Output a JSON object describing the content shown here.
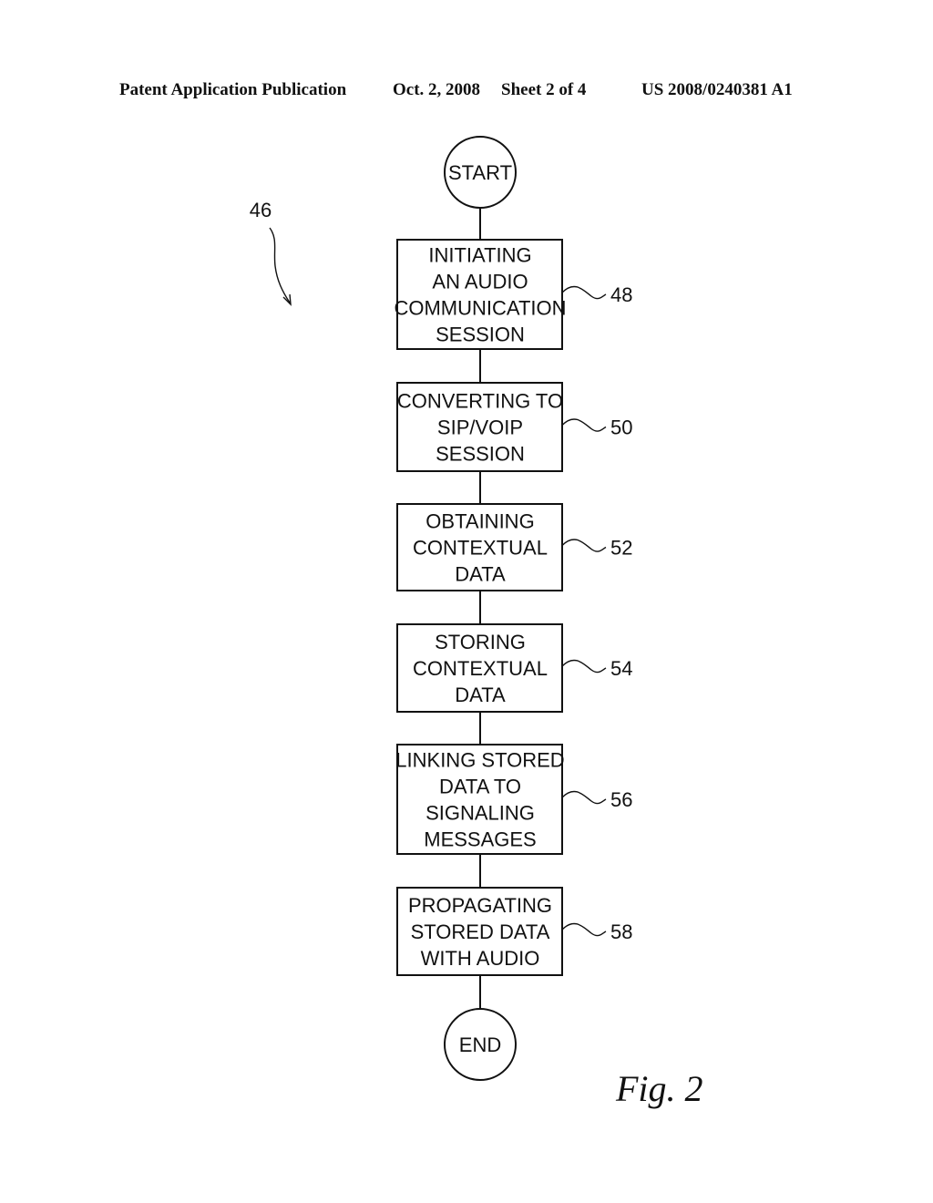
{
  "header": {
    "publication_type": "Patent Application Publication",
    "date": "Oct. 2, 2008",
    "sheet": "Sheet 2 of 4",
    "publication_number": "US 2008/0240381 A1"
  },
  "figure": {
    "label": "Fig. 2",
    "reference_number": "46",
    "start_label": "START",
    "end_label": "END",
    "steps": [
      {
        "ref": "48",
        "lines": [
          "INITIATING",
          "AN AUDIO",
          "COMMUNICATION",
          "SESSION"
        ]
      },
      {
        "ref": "50",
        "lines": [
          "CONVERTING TO",
          "SIP/VOIP",
          "SESSION"
        ]
      },
      {
        "ref": "52",
        "lines": [
          "OBTAINING",
          "CONTEXTUAL",
          "DATA"
        ]
      },
      {
        "ref": "54",
        "lines": [
          "STORING",
          "CONTEXTUAL",
          "DATA"
        ]
      },
      {
        "ref": "56",
        "lines": [
          "LINKING STORED",
          "DATA TO",
          "SIGNALING",
          "MESSAGES"
        ]
      },
      {
        "ref": "58",
        "lines": [
          "PROPAGATING",
          "STORED DATA",
          "WITH AUDIO"
        ]
      }
    ]
  }
}
